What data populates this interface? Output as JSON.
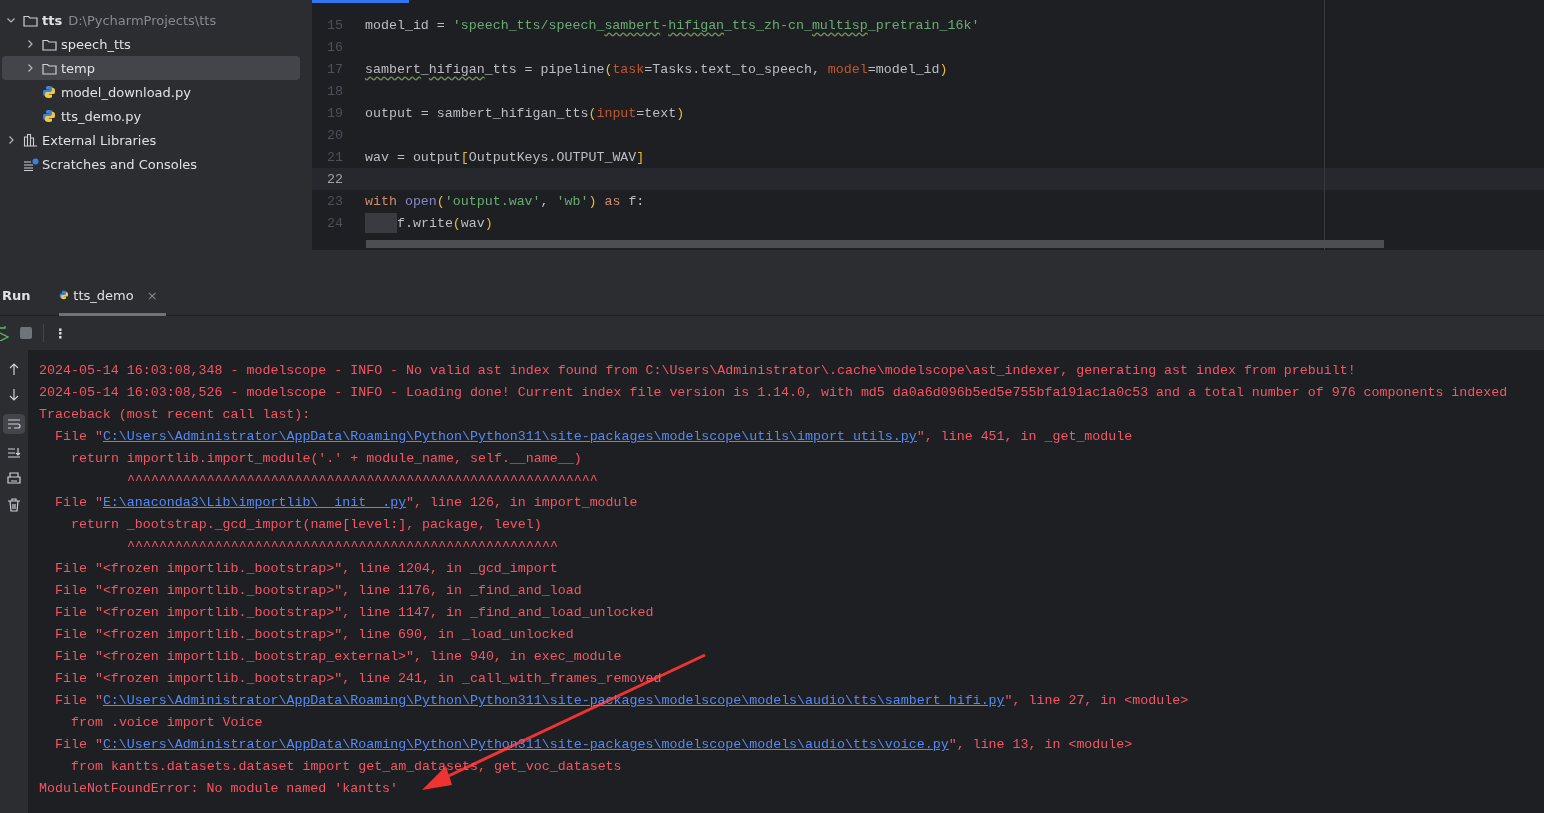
{
  "project_tree": {
    "items": [
      {
        "label": "tts",
        "hint": "D:\\PycharmProjects\\tts",
        "kind": "folder",
        "expanded": true,
        "selected": false,
        "children": [
          {
            "label": "speech_tts",
            "kind": "folder",
            "expanded": false,
            "selected": false
          },
          {
            "label": "temp",
            "kind": "folder",
            "expanded": false,
            "selected": true
          },
          {
            "label": "model_download.py",
            "kind": "python",
            "selected": false
          },
          {
            "label": "tts_demo.py",
            "kind": "python",
            "selected": false
          }
        ]
      },
      {
        "label": "External Libraries",
        "kind": "library",
        "expanded": false,
        "selected": false
      },
      {
        "label": "Scratches and Consoles",
        "kind": "scratches",
        "selected": false
      }
    ]
  },
  "editor": {
    "lines": [
      {
        "number": "15",
        "current": false,
        "tokens": [
          {
            "text": "model_id = ",
            "kind": "plain"
          },
          {
            "text": "'speech_tts/speech_",
            "kind": "string"
          },
          {
            "text": "sambert",
            "kind": "string",
            "squiggle": true
          },
          {
            "text": "-",
            "kind": "string"
          },
          {
            "text": "hifigan",
            "kind": "string",
            "squiggle": true
          },
          {
            "text": "_tts_zh-cn_",
            "kind": "string"
          },
          {
            "text": "multisp",
            "kind": "string",
            "squiggle": true
          },
          {
            "text": "_pretrain_16k'",
            "kind": "string"
          }
        ]
      },
      {
        "number": "16",
        "current": false
      },
      {
        "number": "17",
        "current": false,
        "tokens": [
          {
            "text": "sambert",
            "kind": "plain",
            "squiggle": true
          },
          {
            "text": "_",
            "kind": "plain"
          },
          {
            "text": "hifigan",
            "kind": "plain",
            "squiggle": true
          },
          {
            "text": "_tts = pipeline",
            "kind": "plain"
          },
          {
            "text": "(",
            "kind": "bracket"
          },
          {
            "text": "task",
            "kind": "param"
          },
          {
            "text": "=Tasks.text_to_speech, ",
            "kind": "plain"
          },
          {
            "text": "model",
            "kind": "param"
          },
          {
            "text": "=model_id",
            "kind": "plain"
          },
          {
            "text": ")",
            "kind": "bracket"
          }
        ]
      },
      {
        "number": "18",
        "current": false
      },
      {
        "number": "19",
        "current": false,
        "tokens": [
          {
            "text": "output = sambert_hifigan_tts",
            "kind": "plain"
          },
          {
            "text": "(",
            "kind": "bracket"
          },
          {
            "text": "input",
            "kind": "param"
          },
          {
            "text": "=text",
            "kind": "plain"
          },
          {
            "text": ")",
            "kind": "bracket"
          }
        ]
      },
      {
        "number": "20",
        "current": false
      },
      {
        "number": "21",
        "current": false,
        "tokens": [
          {
            "text": "wav = output",
            "kind": "plain"
          },
          {
            "text": "[",
            "kind": "bracket"
          },
          {
            "text": "OutputKeys.OUTPUT_WAV",
            "kind": "plain"
          },
          {
            "text": "]",
            "kind": "bracket"
          }
        ]
      },
      {
        "number": "22",
        "current": true
      },
      {
        "number": "23",
        "current": false,
        "tokens": [
          {
            "text": "with ",
            "kind": "keyword"
          },
          {
            "text": "open",
            "kind": "builtin"
          },
          {
            "text": "(",
            "kind": "bracket"
          },
          {
            "text": "'output.wav'",
            "kind": "string"
          },
          {
            "text": ", ",
            "kind": "plain"
          },
          {
            "text": "'wb'",
            "kind": "string"
          },
          {
            "text": ")",
            "kind": "bracket"
          },
          {
            "text": " as",
            "kind": "keyword"
          },
          {
            "text": " f:",
            "kind": "plain"
          }
        ]
      },
      {
        "number": "24",
        "current": false,
        "indent": true,
        "tokens": [
          {
            "text": "f.write",
            "kind": "plain"
          },
          {
            "text": "(",
            "kind": "bracket"
          },
          {
            "text": "wav",
            "kind": "plain"
          },
          {
            "text": ")",
            "kind": "bracket"
          }
        ]
      }
    ]
  },
  "run_panel": {
    "title": "Run",
    "tabs": [
      {
        "label": "tts_demo",
        "selected": true,
        "close": "×"
      }
    ],
    "menu": "⋮",
    "console": [
      {
        "kind": "log",
        "parts": [
          {
            "text": "2024-05-14 16:03:08,348 - modelscope - INFO - No valid ast index found from C:\\Users\\Administrator\\.cache\\modelscope\\ast_indexer, generating ast index from prebuilt!"
          }
        ]
      },
      {
        "kind": "log",
        "parts": [
          {
            "text": "2024-05-14 16:03:08,526 - modelscope - INFO - Loading done! Current index file version is 1.14.0, with md5 da0a6d096b5ed5e755bfa191ac1a0c53 and a total number of 976 components indexed"
          }
        ]
      },
      {
        "kind": "log",
        "parts": [
          {
            "text": "Traceback (most recent call last):"
          }
        ]
      },
      {
        "kind": "frame",
        "parts": [
          {
            "text": "File \""
          },
          {
            "text": "C:\\Users\\Administrator\\AppData\\Roaming\\Python\\Python311\\site-packages\\modelscope\\utils\\import_utils.py",
            "link": true
          },
          {
            "text": "\", line 451, in _get_module"
          }
        ]
      },
      {
        "kind": "source",
        "parts": [
          {
            "text": "return importlib.import_module('.' + module_name, self.__name__)"
          }
        ]
      },
      {
        "kind": "carets",
        "parts": [
          {
            "text": "^^^^^^^^^^^^^^^^^^^^^^^^^^^^^^^^^^^^^^^^^^^^^^^^^^^^^^^^^^^"
          }
        ]
      },
      {
        "kind": "frame",
        "parts": [
          {
            "text": "File \""
          },
          {
            "text": "E:\\anaconda3\\Lib\\importlib\\__init__.py",
            "link": true
          },
          {
            "text": "\", line 126, in import_module"
          }
        ]
      },
      {
        "kind": "source",
        "parts": [
          {
            "text": "return _bootstrap._gcd_import(name[level:], package, level)"
          }
        ]
      },
      {
        "kind": "carets",
        "parts": [
          {
            "text": "^^^^^^^^^^^^^^^^^^^^^^^^^^^^^^^^^^^^^^^^^^^^^^^^^^^^^^"
          }
        ]
      },
      {
        "kind": "frame",
        "parts": [
          {
            "text": "File \"<frozen importlib._bootstrap>\", line 1204, in _gcd_import"
          }
        ]
      },
      {
        "kind": "frame",
        "parts": [
          {
            "text": "File \"<frozen importlib._bootstrap>\", line 1176, in _find_and_load"
          }
        ]
      },
      {
        "kind": "frame",
        "parts": [
          {
            "text": "File \"<frozen importlib._bootstrap>\", line 1147, in _find_and_load_unlocked"
          }
        ]
      },
      {
        "kind": "frame",
        "parts": [
          {
            "text": "File \"<frozen importlib._bootstrap>\", line 690, in _load_unlocked"
          }
        ]
      },
      {
        "kind": "frame",
        "parts": [
          {
            "text": "File \"<frozen importlib._bootstrap_external>\", line 940, in exec_module"
          }
        ]
      },
      {
        "kind": "frame",
        "parts": [
          {
            "text": "File \"<frozen importlib._bootstrap>\", line 241, in _call_with_frames_removed"
          }
        ]
      },
      {
        "kind": "frame",
        "parts": [
          {
            "text": "File \""
          },
          {
            "text": "C:\\Users\\Administrator\\AppData\\Roaming\\Python\\Python311\\site-packages\\modelscope\\models\\audio\\tts\\sambert_hifi.py",
            "link": true
          },
          {
            "text": "\", line 27, in <module>"
          }
        ]
      },
      {
        "kind": "source",
        "parts": [
          {
            "text": "from .voice import Voice"
          }
        ]
      },
      {
        "kind": "frame",
        "parts": [
          {
            "text": "File \""
          },
          {
            "text": "C:\\Users\\Administrator\\AppData\\Roaming\\Python\\Python311\\site-packages\\modelscope\\models\\audio\\tts\\voice.py",
            "link": true
          },
          {
            "text": "\", line 13, in <module>"
          }
        ]
      },
      {
        "kind": "source",
        "parts": [
          {
            "text": "from kantts.datasets.dataset import get_am_datasets, get_voc_datasets"
          }
        ]
      },
      {
        "kind": "log",
        "parts": [
          {
            "text": "ModuleNotFoundError: No module named 'kantts'"
          }
        ]
      }
    ]
  }
}
